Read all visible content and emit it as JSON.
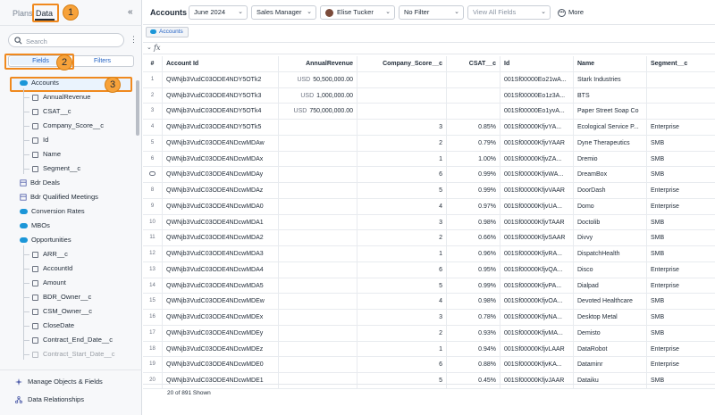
{
  "sidebar": {
    "tabs": {
      "plans": "Plans",
      "data": "Data"
    },
    "collapse_icon": "«",
    "search": {
      "placeholder": "Search"
    },
    "kebab_icon": "⋮",
    "segments": {
      "fields": "Fields",
      "filters": "Filters"
    },
    "tree": [
      {
        "label": "Accounts",
        "type": "object",
        "selected": true
      },
      {
        "label": "AnnualRevenue",
        "type": "field"
      },
      {
        "label": "CSAT__c",
        "type": "field"
      },
      {
        "label": "Company_Score__c",
        "type": "field"
      },
      {
        "label": "Id",
        "type": "field"
      },
      {
        "label": "Name",
        "type": "field"
      },
      {
        "label": "Segment__c",
        "type": "field"
      },
      {
        "label": "Bdr Deals",
        "type": "dataset"
      },
      {
        "label": "Bdr Qualified Meetings",
        "type": "dataset"
      },
      {
        "label": "Conversion Rates",
        "type": "object"
      },
      {
        "label": "MBOs",
        "type": "object"
      },
      {
        "label": "Opportunities",
        "type": "object"
      },
      {
        "label": "ARR__c",
        "type": "field"
      },
      {
        "label": "AccountId",
        "type": "field"
      },
      {
        "label": "Amount",
        "type": "field"
      },
      {
        "label": "BDR_Owner__c",
        "type": "field"
      },
      {
        "label": "CSM_Owner__c",
        "type": "field"
      },
      {
        "label": "CloseDate",
        "type": "field"
      },
      {
        "label": "Contract_End_Date__c",
        "type": "field"
      },
      {
        "label": "Contract_Start_Date__c",
        "type": "field"
      }
    ],
    "bottom_links": {
      "manage": "Manage Objects & Fields",
      "relationships": "Data Relationships"
    }
  },
  "annotations": {
    "badge1": "1",
    "badge2": "2",
    "badge3": "3"
  },
  "toolbar": {
    "title": "Accounts",
    "period": "June 2024",
    "role": "Sales Manager",
    "user": "Elise Tucker",
    "filter": "No Filter",
    "fields_placeholder": "View All Fields",
    "more": "More"
  },
  "chip": {
    "label": "Accounts"
  },
  "fx": {
    "label": "fx"
  },
  "table": {
    "headers": [
      "#",
      "Account Id",
      "AnnualRevenue",
      "Company_Score__c",
      "CSAT__c",
      "Id",
      "Name",
      "Segment__c"
    ],
    "rows": [
      {
        "n": "1",
        "acc": "QWNjb3VudC03ODE4NDY5OTk2",
        "usd": "USD",
        "rev": "50,500,000.00",
        "score": "",
        "csat": "",
        "id": "001Sf00000Eo21wA...",
        "name": "Stark Industries",
        "seg": ""
      },
      {
        "n": "2",
        "acc": "QWNjb3VudC03ODE4NDY5OTk3",
        "usd": "USD",
        "rev": "1,000,000.00",
        "score": "",
        "csat": "",
        "id": "001Sf00000Eo1z3A...",
        "name": "BTS",
        "seg": ""
      },
      {
        "n": "3",
        "acc": "QWNjb3VudC03ODE4NDY5OTk4",
        "usd": "USD",
        "rev": "750,000,000.00",
        "score": "",
        "csat": "",
        "id": "001Sf00000Eo1yvA...",
        "name": "Paper Street Soap Co",
        "seg": ""
      },
      {
        "n": "4",
        "acc": "QWNjb3VudC03ODE4NDY5OTk5",
        "usd": "",
        "rev": "",
        "score": "3",
        "csat": "0.85%",
        "id": "001Sf00000KfjvYA...",
        "name": "Ecological Service P...",
        "seg": "Enterprise"
      },
      {
        "n": "5",
        "acc": "QWNjb3VudC03ODE4NDcwMDAw",
        "usd": "",
        "rev": "",
        "score": "2",
        "csat": "0.79%",
        "id": "001Sf00000KfjvYAAR",
        "name": "Dyne Therapeutics",
        "seg": "SMB"
      },
      {
        "n": "6",
        "acc": "QWNjb3VudC03ODE4NDcwMDAx",
        "usd": "",
        "rev": "",
        "score": "1",
        "csat": "1.00%",
        "id": "001Sf00000KfjvZA...",
        "name": "Dremio",
        "seg": "SMB"
      },
      {
        "n": "",
        "acc": "QWNjb3VudC03ODE4NDcwMDAy",
        "usd": "",
        "rev": "",
        "score": "6",
        "csat": "0.99%",
        "id": "001Sf00000KfjvWA...",
        "name": "DreamBox",
        "seg": "SMB",
        "link": true
      },
      {
        "n": "8",
        "acc": "QWNjb3VudC03ODE4NDcwMDAz",
        "usd": "",
        "rev": "",
        "score": "5",
        "csat": "0.99%",
        "id": "001Sf00000KfjvVAAR",
        "name": "DoorDash",
        "seg": "Enterprise"
      },
      {
        "n": "9",
        "acc": "QWNjb3VudC03ODE4NDcwMDA0",
        "usd": "",
        "rev": "",
        "score": "4",
        "csat": "0.97%",
        "id": "001Sf00000KfjvUA...",
        "name": "Domo",
        "seg": "Enterprise"
      },
      {
        "n": "10",
        "acc": "QWNjb3VudC03ODE4NDcwMDA1",
        "usd": "",
        "rev": "",
        "score": "3",
        "csat": "0.98%",
        "id": "001Sf00000KfjvTAAR",
        "name": "Doctolib",
        "seg": "SMB"
      },
      {
        "n": "11",
        "acc": "QWNjb3VudC03ODE4NDcwMDA2",
        "usd": "",
        "rev": "",
        "score": "2",
        "csat": "0.66%",
        "id": "001Sf00000KfjvSAAR",
        "name": "Divvy",
        "seg": "SMB"
      },
      {
        "n": "12",
        "acc": "QWNjb3VudC03ODE4NDcwMDA3",
        "usd": "",
        "rev": "",
        "score": "1",
        "csat": "0.96%",
        "id": "001Sf00000KfjvRA...",
        "name": "DispatchHealth",
        "seg": "SMB"
      },
      {
        "n": "13",
        "acc": "QWNjb3VudC03ODE4NDcwMDA4",
        "usd": "",
        "rev": "",
        "score": "6",
        "csat": "0.95%",
        "id": "001Sf00000KfjvQA...",
        "name": "Disco",
        "seg": "Enterprise"
      },
      {
        "n": "14",
        "acc": "QWNjb3VudC03ODE4NDcwMDA5",
        "usd": "",
        "rev": "",
        "score": "5",
        "csat": "0.99%",
        "id": "001Sf00000KfjvPA...",
        "name": "Dialpad",
        "seg": "Enterprise"
      },
      {
        "n": "15",
        "acc": "QWNjb3VudC03ODE4NDcwMDEw",
        "usd": "",
        "rev": "",
        "score": "4",
        "csat": "0.98%",
        "id": "001Sf00000KfjvOA...",
        "name": "Devoted Healthcare",
        "seg": "SMB"
      },
      {
        "n": "16",
        "acc": "QWNjb3VudC03ODE4NDcwMDEx",
        "usd": "",
        "rev": "",
        "score": "3",
        "csat": "0.78%",
        "id": "001Sf00000KfjvNA...",
        "name": "Desktop Metal",
        "seg": "SMB"
      },
      {
        "n": "17",
        "acc": "QWNjb3VudC03ODE4NDcwMDEy",
        "usd": "",
        "rev": "",
        "score": "2",
        "csat": "0.93%",
        "id": "001Sf00000KfjvMA...",
        "name": "Demisto",
        "seg": "SMB"
      },
      {
        "n": "18",
        "acc": "QWNjb3VudC03ODE4NDcwMDEz",
        "usd": "",
        "rev": "",
        "score": "1",
        "csat": "0.94%",
        "id": "001Sf00000KfjvLAAR",
        "name": "DataRobot",
        "seg": "Enterprise"
      },
      {
        "n": "19",
        "acc": "QWNjb3VudC03ODE4NDcwMDE0",
        "usd": "",
        "rev": "",
        "score": "6",
        "csat": "0.88%",
        "id": "001Sf00000KfjvKA...",
        "name": "Dataminr",
        "seg": "Enterprise"
      },
      {
        "n": "20",
        "acc": "QWNjb3VudC03ODE4NDcwMDE1",
        "usd": "",
        "rev": "",
        "score": "5",
        "csat": "0.45%",
        "id": "001Sf00000KfjvJAAR",
        "name": "Dataiku",
        "seg": "SMB"
      }
    ],
    "footer": "20 of 891 Shown"
  },
  "colors": {
    "accent": "#2463c4",
    "annotation": "#f0891e",
    "badge": "#f7a23a",
    "salesforce": "#1b96d8"
  }
}
